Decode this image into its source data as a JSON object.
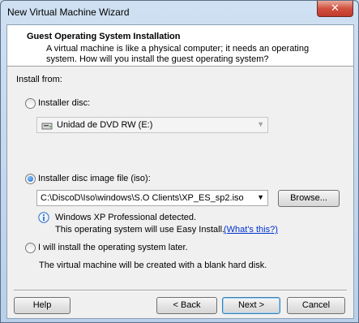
{
  "window": {
    "title": "New Virtual Machine Wizard",
    "close_glyph": "✕"
  },
  "header": {
    "title": "Guest Operating System Installation",
    "description_line1": "A virtual machine is like a physical computer; it needs an operating",
    "description_line2": "system. How will you install the guest operating system?"
  },
  "install_from": {
    "label": "Install from:",
    "installer_disc": {
      "label": "Installer disc:",
      "selected": false,
      "drive_value": "Unidad de DVD RW (E:)"
    },
    "iso_image": {
      "label": "Installer disc image file (iso):",
      "selected": true,
      "path_value": "C:\\DiscoD\\Iso\\windows\\S.O Clients\\XP_ES_sp2.iso",
      "browse_label": "Browse..."
    },
    "detection": {
      "line1": "Windows XP Professional detected.",
      "line2": "This operating system will use Easy Install.",
      "link": "(What's this?)"
    },
    "later": {
      "label": "I will install the operating system later.",
      "selected": false,
      "note": "The virtual machine will be created with a blank hard disk."
    }
  },
  "footer": {
    "help_label": "Help",
    "back_label": "< Back",
    "next_label": "Next >",
    "cancel_label": "Cancel"
  }
}
